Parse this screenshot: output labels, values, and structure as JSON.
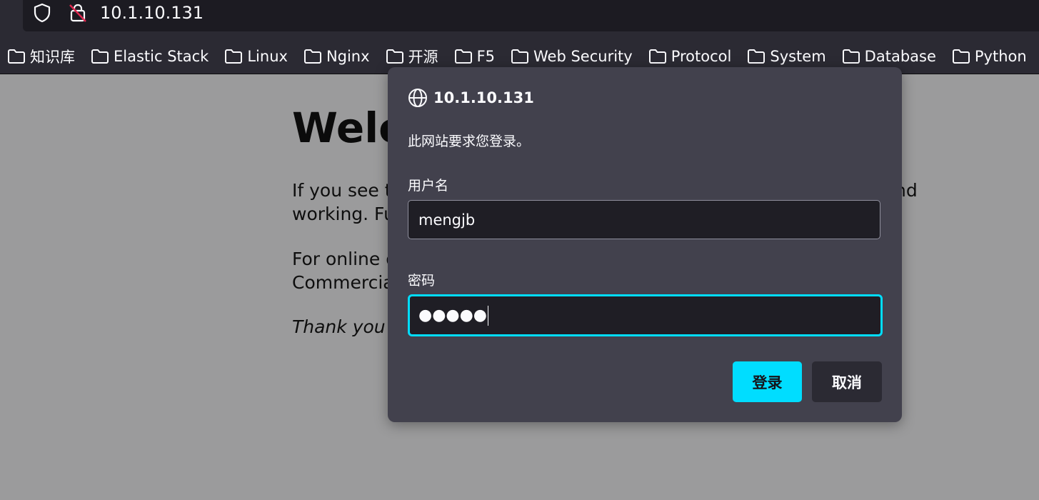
{
  "browser": {
    "url": "10.1.10.131",
    "icons": {
      "tracking": "shield-icon",
      "security": "lock-insecure-icon",
      "bookmark": "folder-icon"
    },
    "bookmarks": [
      "知识库",
      "Elastic Stack",
      "Linux",
      "Nginx",
      "开源",
      "F5",
      "Web Security",
      "Protocol",
      "System",
      "Database",
      "Python"
    ]
  },
  "page": {
    "heading": "Welco",
    "p1_start": "If you see t",
    "p1_line2": "working. Fu",
    "p1_tail": "nd",
    "p2_line1": "For online d",
    "p2_line2": "Commercia",
    "p3": "Thank you"
  },
  "dialog": {
    "host": "10.1.10.131",
    "message": "此网站要求您登录。",
    "username_label": "用户名",
    "username_value": "mengjb",
    "password_label": "密码",
    "password_mask": "●●●●●",
    "login_label": "登录",
    "cancel_label": "取消",
    "colors": {
      "accent": "#00ddff",
      "dialog_bg": "#42414d",
      "field_bg": "#1f1e25"
    }
  }
}
